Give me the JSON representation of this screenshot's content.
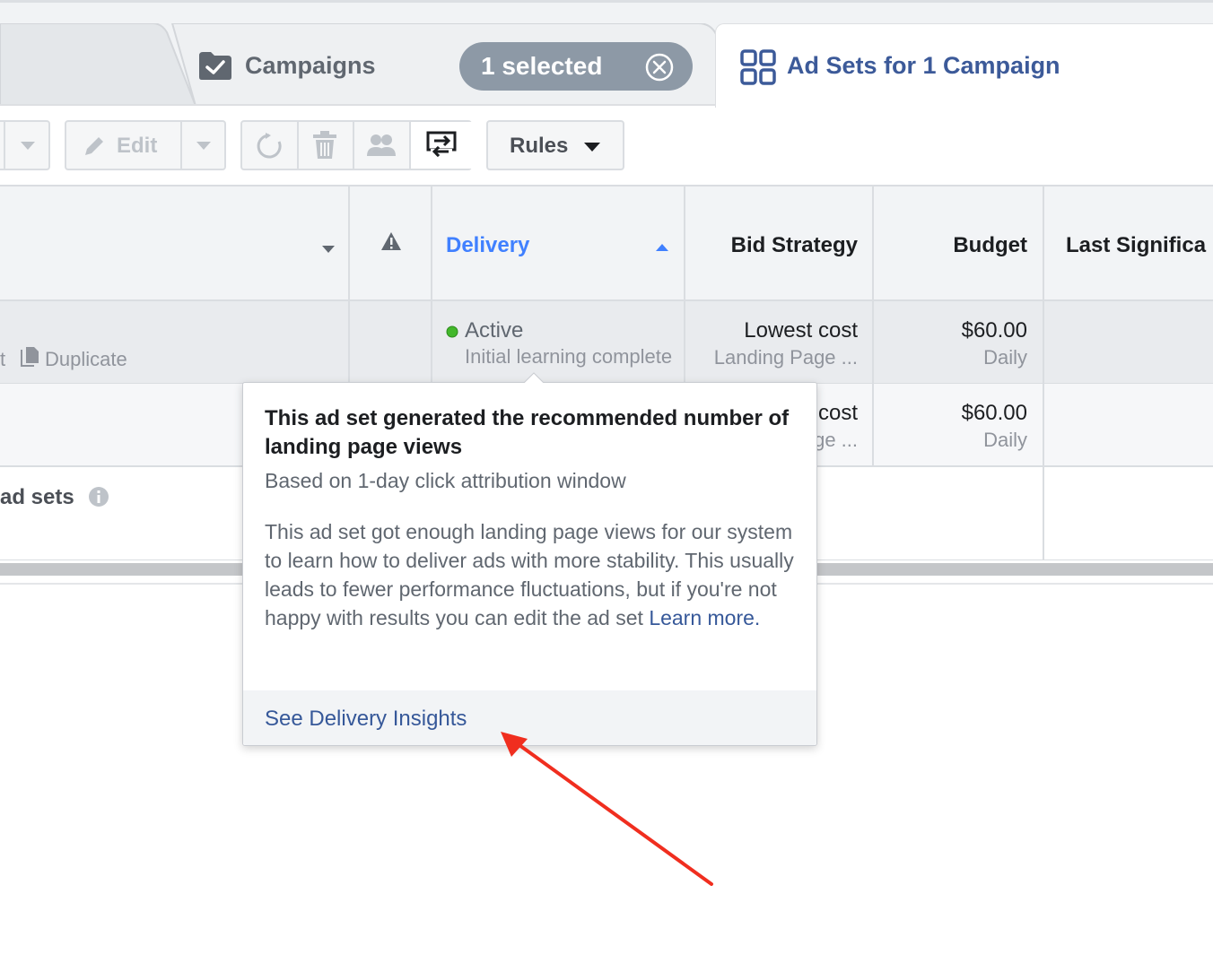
{
  "tabs": {
    "campaigns_label": "Campaigns",
    "selected_label": "1 selected",
    "adsets_label": "Ad Sets for 1 Campaign"
  },
  "toolbar": {
    "edit_label": "Edit",
    "rules_label": "Rules"
  },
  "table": {
    "columns": {
      "delivery": "Delivery",
      "bid_strategy": "Bid Strategy",
      "budget": "Budget",
      "last_significant": "Last Significa"
    },
    "rows": [
      {
        "name_action": "Duplicate",
        "name_fragment": "t",
        "delivery_status": "Active",
        "delivery_sub": "Initial learning complete",
        "bid": "Lowest cost",
        "bid_sub": "Landing Page ...",
        "budget": "$60.00",
        "budget_sub": "Daily"
      },
      {
        "bid": "cost",
        "bid_sub": "ge ...",
        "budget": "$60.00",
        "budget_sub": "Daily"
      }
    ],
    "summary_label": "ad sets"
  },
  "popover": {
    "title": "This ad set generated the recommended number of landing page views",
    "subtitle": "Based on 1-day click attribution window",
    "body": "This ad set got enough landing page views for our system to learn how to deliver ads with more stability. This usually leads to fewer performance fluctuations, but if you're not happy with results you can edit the ad set ",
    "learn_more": "Learn more.",
    "footer_link": "See Delivery Insights"
  },
  "colors": {
    "accent_blue": "#4080ff",
    "link_blue": "#365899",
    "status_green": "#42b72a",
    "annotation_red": "#f02e1f"
  }
}
